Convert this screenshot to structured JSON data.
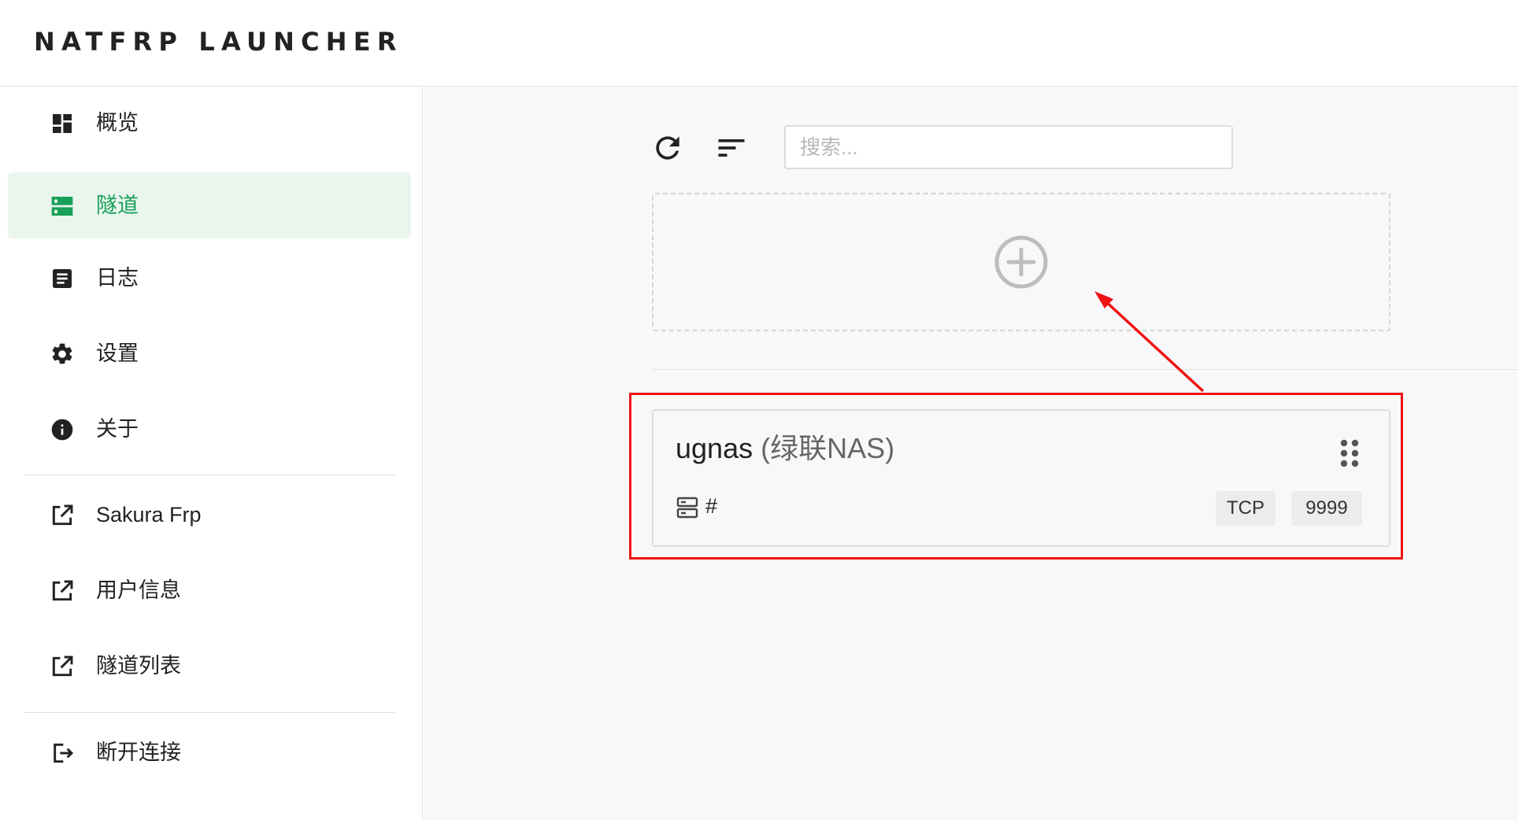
{
  "app": {
    "title": "NATFRP LAUNCHER"
  },
  "sidebar": {
    "items": [
      {
        "label": "概览",
        "icon": "dashboard-icon"
      },
      {
        "label": "隧道",
        "icon": "tunnels-icon",
        "active": true
      },
      {
        "label": "日志",
        "icon": "log-icon"
      },
      {
        "label": "设置",
        "icon": "gear-icon"
      },
      {
        "label": "关于",
        "icon": "info-icon"
      },
      {
        "label": "Sakura Frp",
        "icon": "external-link-icon"
      },
      {
        "label": "用户信息",
        "icon": "external-link-icon"
      },
      {
        "label": "隧道列表",
        "icon": "external-link-icon"
      },
      {
        "label": "断开连接",
        "icon": "logout-icon"
      }
    ]
  },
  "toolbar": {
    "refresh_icon": "refresh-icon",
    "sort_icon": "sort-icon",
    "search_placeholder": "搜索...",
    "search_value": ""
  },
  "add_tunnel": {
    "icon": "add-circle-icon"
  },
  "tunnels": [
    {
      "name": "ugnas",
      "note": "(绿联NAS)",
      "node_label": "#",
      "protocol": "TCP",
      "port": "9999"
    }
  ],
  "annotation": {
    "color": "#f01414"
  },
  "colors": {
    "accent": "#18a058",
    "active_bg": "#eaf5ee",
    "main_bg": "#f8f8fa"
  }
}
